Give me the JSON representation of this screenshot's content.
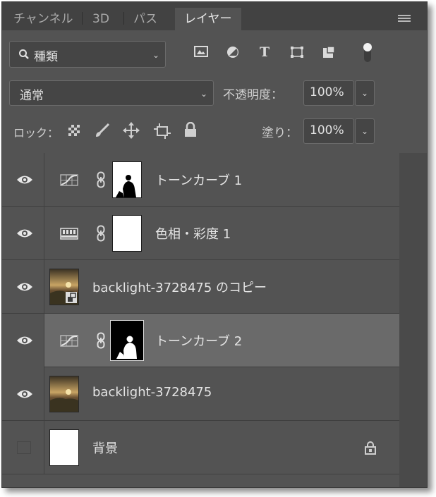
{
  "tabs": [
    {
      "label": "チャンネル",
      "active": false
    },
    {
      "label": "3D",
      "active": false
    },
    {
      "label": "パス",
      "active": false
    },
    {
      "label": "レイヤー",
      "active": true
    }
  ],
  "filter": {
    "icon": "search-icon",
    "value": "種類"
  },
  "blend_mode": "通常",
  "opacity": {
    "label": "不透明度：",
    "value": "100%"
  },
  "lock": {
    "label": "ロック：",
    "icons": [
      "lock-transparent-pixels-icon",
      "lock-image-pixels-icon",
      "lock-position-icon",
      "lock-artboard-icon",
      "lock-all-icon"
    ]
  },
  "fill": {
    "label": "塗り：",
    "value": "100%"
  },
  "filter_icons": [
    "pixel-layer-filter-icon",
    "adjustment-layer-filter-icon",
    "type-layer-filter-icon",
    "shape-layer-filter-icon",
    "smart-object-filter-icon",
    "filter-toggle-icon"
  ],
  "layers": [
    {
      "name": "トーンカーブ 1",
      "type": "curves-adjustment",
      "visible": true,
      "selected": false
    },
    {
      "name": "色相・彩度 1",
      "type": "hue-saturation-adjustment",
      "visible": true,
      "selected": false
    },
    {
      "name": "backlight-3728475 のコピー",
      "type": "smart-object",
      "visible": true,
      "selected": false
    },
    {
      "name": "トーンカーブ 2",
      "type": "curves-adjustment",
      "visible": true,
      "selected": true
    },
    {
      "name": "backlight-3728475",
      "type": "photo",
      "visible": true,
      "selected": false
    },
    {
      "name": "背景",
      "type": "background",
      "visible": false,
      "selected": false,
      "locked": true
    }
  ],
  "colors": {
    "panel": "#535353",
    "tabbar": "#424242",
    "selected_row": "#6a6a6a",
    "text": "#e4e4e4"
  }
}
